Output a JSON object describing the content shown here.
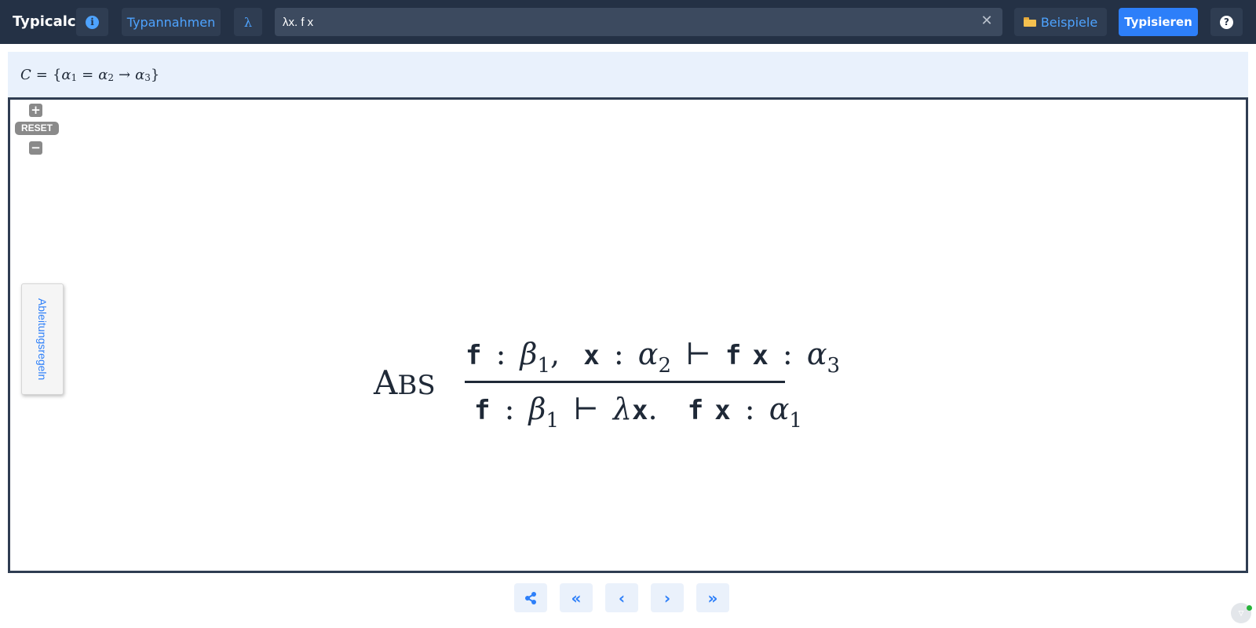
{
  "app": {
    "title": "Typicalc"
  },
  "toolbar": {
    "info_icon_glyph": "i",
    "assumptions_label": "Typannahmen",
    "lambda_label": "λ",
    "expression_value": "λx. f x",
    "clear_glyph": "✕",
    "examples_label": "Beispiele",
    "type_button_label": "Typisieren",
    "help_icon_glyph": "?"
  },
  "constraints": {
    "C": "C",
    "equals": "=",
    "open_brace": "{",
    "alpha": "α",
    "sub1": "1",
    "sub2": "2",
    "sub3": "3",
    "arrow": "→",
    "close_brace": "}"
  },
  "tree_controls": {
    "zoom_in_glyph": "+",
    "reset_label": "RESET",
    "zoom_out_glyph": "−",
    "rules_tab_label": "Ableitungsregeln"
  },
  "derivation": {
    "rule_first": "A",
    "rule_rest": "BS",
    "f": "f",
    "x": "x",
    "colon": ":",
    "comma": ",",
    "turnstile": "⊢",
    "beta": "β",
    "alpha": "α",
    "lambda": "λ",
    "dot": ".",
    "sub1": "1",
    "sub2": "2",
    "sub3": "3"
  },
  "navigation": {
    "first_glyph": "«",
    "prev_glyph": "‹",
    "next_glyph": "›",
    "last_glyph": "»"
  },
  "colors": {
    "topbar": "#243145",
    "accent": "#2d7ff9",
    "constraint_band": "#e9f1fc",
    "tree_border": "#2f3d52"
  }
}
